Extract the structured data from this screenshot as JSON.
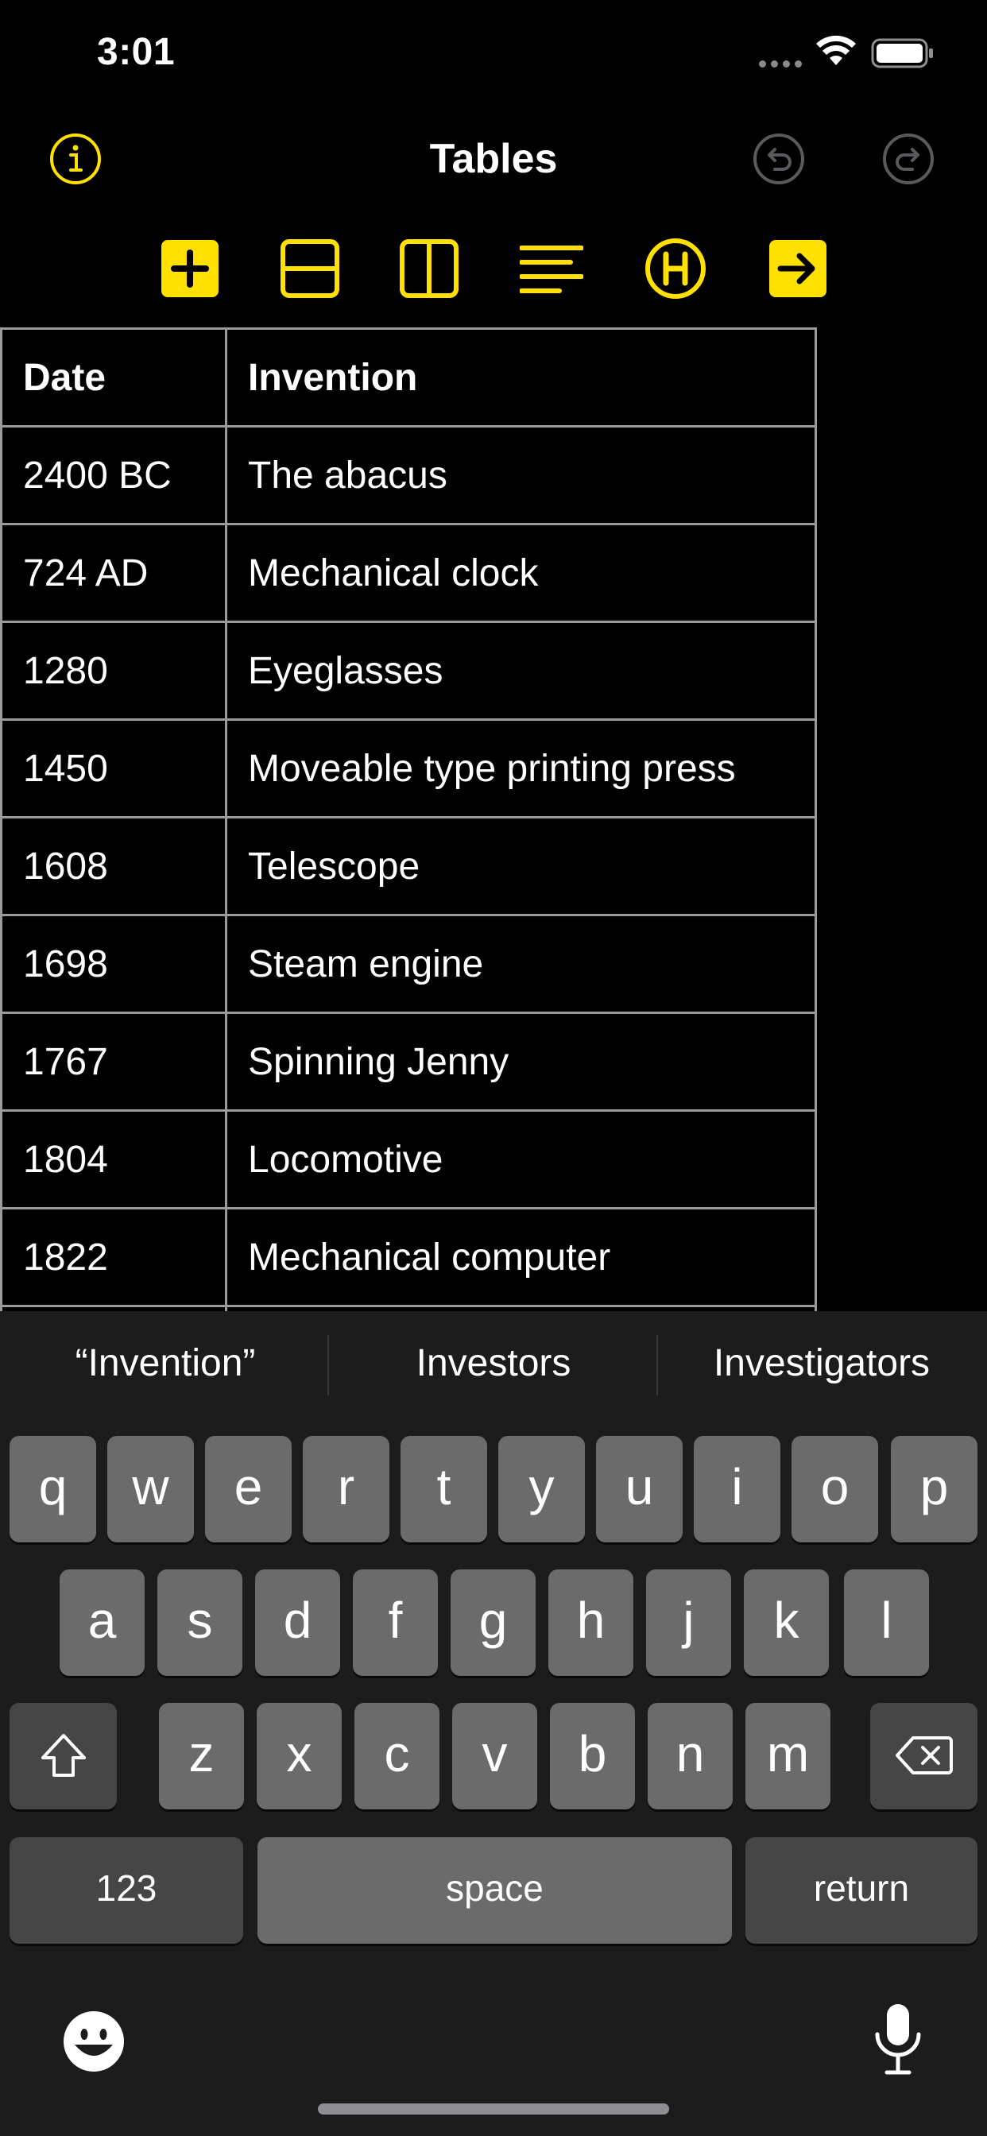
{
  "status_bar": {
    "time": "3:01"
  },
  "nav": {
    "title": "Tables"
  },
  "colors": {
    "accent": "#FFE000",
    "background": "#000000",
    "keyboard_bg": "#1C1C1C",
    "key_light": "#6B6B6B",
    "key_dark": "#464646"
  },
  "toolbar": {
    "tools": [
      "add-icon",
      "insert-row-icon",
      "insert-column-icon",
      "align-icon",
      "header-icon",
      "next-cell-icon"
    ]
  },
  "table": {
    "headers": [
      "Date",
      "Invention"
    ],
    "rows": [
      [
        "2400 BC",
        "The abacus"
      ],
      [
        "724 AD",
        "Mechanical clock"
      ],
      [
        "1280",
        "Eyeglasses"
      ],
      [
        "1450",
        "Moveable type printing press"
      ],
      [
        "1608",
        "Telescope"
      ],
      [
        "1698",
        "Steam engine"
      ],
      [
        "1767",
        "Spinning Jenny"
      ],
      [
        "1804",
        "Locomotive"
      ],
      [
        "1822",
        "Mechanical computer"
      ],
      [
        "",
        ""
      ]
    ]
  },
  "keyboard": {
    "suggestions": [
      "“Invention”",
      "Investors",
      "Investigators"
    ],
    "row1": [
      "q",
      "w",
      "e",
      "r",
      "t",
      "y",
      "u",
      "i",
      "o",
      "p"
    ],
    "row2": [
      "a",
      "s",
      "d",
      "f",
      "g",
      "h",
      "j",
      "k",
      "l"
    ],
    "row3": [
      "z",
      "x",
      "c",
      "v",
      "b",
      "n",
      "m"
    ],
    "numbers_label": "123",
    "space_label": "space",
    "return_label": "return"
  }
}
